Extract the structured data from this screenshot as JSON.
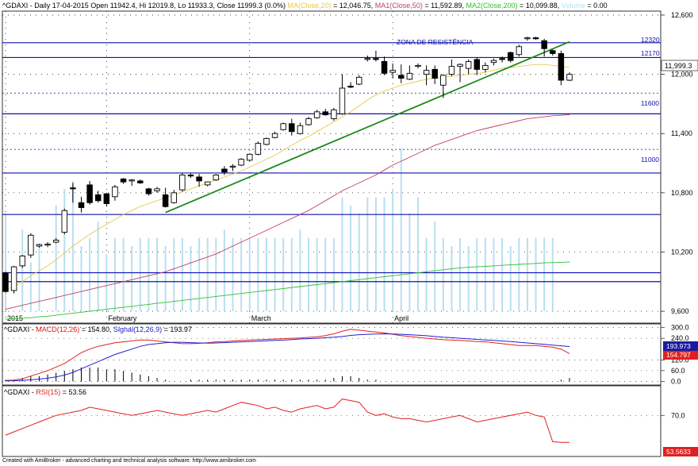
{
  "header": {
    "symbol_line": "^GDAXI - Daily 17-04-2015 Open 11942.4, Hi 12019.8, Lo 11933.3, Close 11999.3 (0.0%)",
    "ma20_label": "MA(Close,20)",
    "ma20_value": " = 12,046.75,",
    "ma50_label": "MA1(Close,50)",
    "ma50_value": " = 11,592.89,",
    "ma200_label": "MA2(Close,200)",
    "ma200_value": " = 10,099.88,",
    "volume_label": "Volume",
    "volume_value": " = 0.00"
  },
  "annotation": "ZONA DE RESISTÊNCIA",
  "price_tag": "11,999.3",
  "level_labels": [
    "12320",
    "12170",
    "11600",
    "11000"
  ],
  "macd_header": {
    "prefix": "^GDAXI - ",
    "macd_label": "MACD(12,26)",
    "macd_value": " = 154.80, ",
    "signal_label": "Signal(12,26,9)",
    "signal_value": " = 193.97"
  },
  "macd_tags": [
    "193.973",
    "154.797"
  ],
  "rsi_header": {
    "prefix": "^GDAXI - ",
    "rsi_label": "RSI(15)",
    "rsi_value": " = 53.56"
  },
  "rsi_tag": "53.5633",
  "footer": "Created with AmiBroker - advanced charting and technical analysis software. http://www.amibroker.com",
  "colors": {
    "ma20": "#e8c84a",
    "ma50": "#c04060",
    "ma200": "#2ec22e",
    "macd": "#e02020",
    "signal": "#2020d0",
    "rsi": "#e02020",
    "levels": "#1010b0",
    "trendline": "#1a8a1a",
    "volume": "#b8dff0"
  },
  "chart_data": [
    {
      "type": "candlestick",
      "title": "^GDAXI - Daily",
      "y_ticks": [
        9600,
        10200,
        10800,
        11400,
        12000,
        12600
      ],
      "ylim": [
        9480,
        12640
      ],
      "x_labels": [
        "2015",
        "February",
        "March",
        "April"
      ],
      "x_label_index": [
        0,
        12,
        29,
        46
      ],
      "candles": [
        [
          9990,
          10000,
          9790,
          9800
        ],
        [
          9810,
          10060,
          9780,
          10050
        ],
        [
          10060,
          10170,
          10040,
          10160
        ],
        [
          10170,
          10390,
          10140,
          10370
        ],
        [
          10260,
          10285,
          10245,
          10275
        ],
        [
          10270,
          10300,
          10250,
          10280
        ],
        [
          10300,
          10340,
          10290,
          10320
        ],
        [
          10400,
          10640,
          10380,
          10620
        ],
        [
          10850,
          10900,
          10700,
          10840
        ],
        [
          10700,
          10760,
          10600,
          10650
        ],
        [
          10880,
          10920,
          10680,
          10700
        ],
        [
          10780,
          10820,
          10700,
          10720
        ],
        [
          10790,
          10800,
          10660,
          10690
        ],
        [
          10760,
          10880,
          10720,
          10860
        ],
        [
          10940,
          10950,
          10890,
          10910
        ],
        [
          10920,
          10940,
          10870,
          10930
        ],
        [
          10920,
          10935,
          10890,
          10900
        ],
        [
          10840,
          10850,
          10770,
          10790
        ],
        [
          10820,
          10860,
          10800,
          10840
        ],
        [
          10780,
          10850,
          10650,
          10660
        ],
        [
          10700,
          10830,
          10690,
          10800
        ],
        [
          10830,
          11000,
          10810,
          10980
        ],
        [
          10980,
          10995,
          10950,
          10970
        ],
        [
          10960,
          10990,
          10860,
          10920
        ],
        [
          10880,
          10915,
          10865,
          10910
        ],
        [
          10930,
          10990,
          10920,
          10980
        ],
        [
          11040,
          11070,
          10980,
          11010
        ],
        [
          11060,
          11090,
          11020,
          11070
        ],
        [
          11080,
          11150,
          11070,
          11140
        ],
        [
          11130,
          11200,
          11120,
          11190
        ],
        [
          11190,
          11320,
          11180,
          11300
        ],
        [
          11290,
          11360,
          11280,
          11350
        ],
        [
          11360,
          11420,
          11350,
          11400
        ],
        [
          11440,
          11510,
          11430,
          11500
        ],
        [
          11500,
          11550,
          11380,
          11420
        ],
        [
          11400,
          11510,
          11390,
          11480
        ],
        [
          11490,
          11570,
          11480,
          11550
        ],
        [
          11560,
          11640,
          11550,
          11620
        ],
        [
          11620,
          11650,
          11580,
          11590
        ],
        [
          11550,
          11660,
          11530,
          11640
        ],
        [
          11600,
          12000,
          11590,
          11860
        ],
        [
          11880,
          11920,
          11860,
          11870
        ],
        [
          11900,
          11990,
          11890,
          11970
        ],
        [
          12160,
          12190,
          12130,
          12160
        ],
        [
          12160,
          12240,
          12130,
          12150
        ],
        [
          12130,
          12180,
          11990,
          12010
        ],
        [
          12020,
          12110,
          11960,
          12040
        ],
        [
          11990,
          12100,
          11910,
          11960
        ],
        [
          11950,
          12090,
          11940,
          12010
        ],
        [
          12080,
          12110,
          12060,
          12090
        ],
        [
          12000,
          12090,
          11890,
          12040
        ],
        [
          12050,
          12090,
          11900,
          11960
        ],
        [
          11890,
          12000,
          11760,
          11990
        ],
        [
          12000,
          12150,
          11980,
          12080
        ],
        [
          12080,
          12110,
          11920,
          12100
        ],
        [
          12060,
          12150,
          12000,
          12130
        ],
        [
          12150,
          12170,
          11990,
          12050
        ],
        [
          12050,
          12120,
          12020,
          12090
        ],
        [
          12120,
          12160,
          12090,
          12140
        ],
        [
          12160,
          12180,
          12120,
          12150
        ],
        [
          12220,
          12230,
          12120,
          12140
        ],
        [
          12200,
          12300,
          12180,
          12280
        ],
        [
          12370,
          12380,
          12340,
          12370
        ],
        [
          12370,
          12380,
          12350,
          12360
        ],
        [
          12340,
          12360,
          12180,
          12260
        ],
        [
          12240,
          12250,
          12190,
          12210
        ],
        [
          12210,
          12240,
          11890,
          11940
        ],
        [
          11940,
          12020,
          11930,
          12000
        ]
      ],
      "levels": [
        12320,
        12170,
        11810,
        11600,
        11240,
        11000,
        10580,
        9990,
        9900
      ],
      "level_styles": [
        "solid",
        "solid",
        "dotted",
        "solid",
        "dotted",
        "solid",
        "solid",
        "solid",
        "solid"
      ],
      "trendline": {
        "from_index": 19,
        "from_value": 10600,
        "to_index": 67,
        "to_value": 12330
      },
      "ma20": [
        9820,
        9850,
        9900,
        9960,
        10010,
        10060,
        10120,
        10190,
        10260,
        10320,
        10380,
        10430,
        10480,
        10530,
        10580,
        10620,
        10660,
        10690,
        10720,
        10750,
        10780,
        10810,
        10840,
        10870,
        10900,
        10930,
        10960,
        10990,
        11020,
        11060,
        11100,
        11140,
        11180,
        11230,
        11280,
        11330,
        11370,
        11420,
        11470,
        11520,
        11570,
        11620,
        11680,
        11740,
        11790,
        11830,
        11860,
        11890,
        11910,
        11930,
        11950,
        11960,
        11970,
        11980,
        11990,
        12000,
        12010,
        12020,
        12040,
        12060,
        12070,
        12080,
        12090,
        12100,
        12100,
        12090,
        12080,
        12070
      ],
      "ma50": [
        9620,
        9640,
        9660,
        9680,
        9700,
        9720,
        9740,
        9760,
        9780,
        9800,
        9820,
        9840,
        9860,
        9880,
        9900,
        9920,
        9940,
        9960,
        9980,
        10000,
        10030,
        10060,
        10090,
        10120,
        10150,
        10180,
        10220,
        10260,
        10300,
        10340,
        10380,
        10420,
        10460,
        10500,
        10540,
        10580,
        10620,
        10670,
        10720,
        10770,
        10820,
        10860,
        10900,
        10940,
        10980,
        11030,
        11080,
        11120,
        11160,
        11200,
        11240,
        11280,
        11310,
        11340,
        11370,
        11400,
        11430,
        11450,
        11470,
        11490,
        11510,
        11530,
        11550,
        11560,
        11570,
        11580,
        11585,
        11590
      ],
      "ma200": [
        9520,
        9525,
        9530,
        9535,
        9545,
        9550,
        9560,
        9570,
        9580,
        9590,
        9600,
        9610,
        9620,
        9630,
        9640,
        9650,
        9660,
        9670,
        9680,
        9690,
        9700,
        9710,
        9720,
        9730,
        9740,
        9750,
        9760,
        9770,
        9780,
        9790,
        9800,
        9810,
        9820,
        9830,
        9840,
        9850,
        9860,
        9870,
        9880,
        9890,
        9900,
        9910,
        9920,
        9930,
        9940,
        9950,
        9960,
        9970,
        9980,
        9990,
        10000,
        10010,
        10020,
        10030,
        10040,
        10045,
        10050,
        10055,
        10060,
        10065,
        10070,
        10075,
        10080,
        10085,
        10090,
        10093,
        10096,
        10099
      ],
      "volume": [
        0.6,
        0,
        0.5,
        0.3,
        0.4,
        0,
        0.65,
        0.75,
        0.8,
        0.4,
        0.45,
        0.55,
        0.35,
        0.45,
        0.45,
        0.4,
        0.45,
        0.45,
        0.45,
        0.4,
        0.45,
        0.45,
        0.4,
        0.45,
        0.45,
        0.45,
        0.5,
        0.45,
        0.45,
        0.45,
        0.45,
        0.45,
        0.45,
        0.45,
        0.45,
        0.5,
        0.45,
        0.45,
        0.45,
        0.45,
        0.7,
        0.65,
        0.6,
        0.7,
        0.7,
        0.7,
        0.75,
        1.0,
        0.6,
        0.7,
        0.45,
        0.55,
        0.45,
        0.4,
        0.45,
        0.4,
        0.45,
        0.45,
        0.45,
        0.45,
        0.4,
        0.45,
        0.45,
        0.45,
        0.45,
        0.45,
        0,
        0
      ]
    },
    {
      "type": "line",
      "title": "MACD(12,26)",
      "y_ticks": [
        0.0,
        60.0,
        120.0,
        240.0,
        300.0
      ],
      "ylim": [
        -20,
        320
      ],
      "series": [
        {
          "name": "MACD(12,26)",
          "values": [
            5,
            8,
            15,
            30,
            45,
            60,
            80,
            100,
            130,
            160,
            180,
            195,
            205,
            215,
            220,
            225,
            230,
            230,
            225,
            220,
            215,
            210,
            210,
            212,
            215,
            220,
            222,
            225,
            228,
            230,
            232,
            234,
            236,
            238,
            240,
            242,
            245,
            248,
            255,
            265,
            280,
            290,
            285,
            280,
            275,
            270,
            262,
            255,
            250,
            245,
            240,
            236,
            232,
            230,
            228,
            225,
            222,
            220,
            215,
            210,
            205,
            200,
            200,
            200,
            195,
            190,
            180,
            154.8
          ]
        },
        {
          "name": "Signal(12,26,9)",
          "values": [
            3,
            4,
            6,
            9,
            13,
            18,
            25,
            35,
            50,
            70,
            90,
            110,
            130,
            150,
            165,
            180,
            195,
            205,
            210,
            215,
            218,
            218,
            216,
            214,
            213,
            214,
            216,
            218,
            220,
            222,
            224,
            226,
            228,
            230,
            233,
            236,
            238,
            240,
            243,
            246,
            250,
            256,
            260,
            262,
            264,
            265,
            264,
            262,
            260,
            257,
            254,
            250,
            246,
            243,
            240,
            237,
            234,
            231,
            228,
            225,
            222,
            218,
            214,
            210,
            206,
            202,
            198,
            193.97
          ]
        }
      ],
      "histogram": [
        1,
        1,
        2,
        3,
        3,
        4,
        5,
        6,
        7,
        8,
        8,
        8,
        7,
        7,
        6,
        5,
        4,
        3,
        2,
        1,
        0,
        0,
        1,
        1,
        1,
        1,
        1,
        1,
        1,
        1,
        1,
        1,
        1,
        1,
        1,
        1,
        1,
        1,
        1,
        2,
        3,
        3,
        2,
        1,
        1,
        0,
        0,
        0,
        0,
        0,
        0,
        0,
        0,
        0,
        0,
        0,
        0,
        0,
        0,
        0,
        0,
        0,
        0,
        0,
        0,
        0,
        1,
        2
      ]
    },
    {
      "type": "line",
      "title": "RSI(15)",
      "y_ticks": [
        70.0
      ],
      "ylim": [
        45,
        88
      ],
      "series": [
        {
          "name": "RSI(15)",
          "values": [
            58,
            60,
            62,
            64,
            66,
            68,
            70,
            71,
            72,
            73,
            75,
            74,
            73,
            72,
            71,
            70,
            71,
            72,
            73,
            72,
            71,
            70,
            71,
            72,
            73,
            72,
            74,
            76,
            78,
            77,
            76,
            74,
            75,
            73,
            72,
            74,
            75,
            76,
            74,
            75,
            80,
            79,
            78,
            72,
            70,
            71,
            69,
            68,
            68,
            67,
            66,
            67,
            68,
            69,
            70,
            68,
            66,
            67,
            68,
            69,
            70,
            71,
            72,
            70,
            69,
            54,
            53.6,
            53.56
          ]
        }
      ]
    }
  ]
}
